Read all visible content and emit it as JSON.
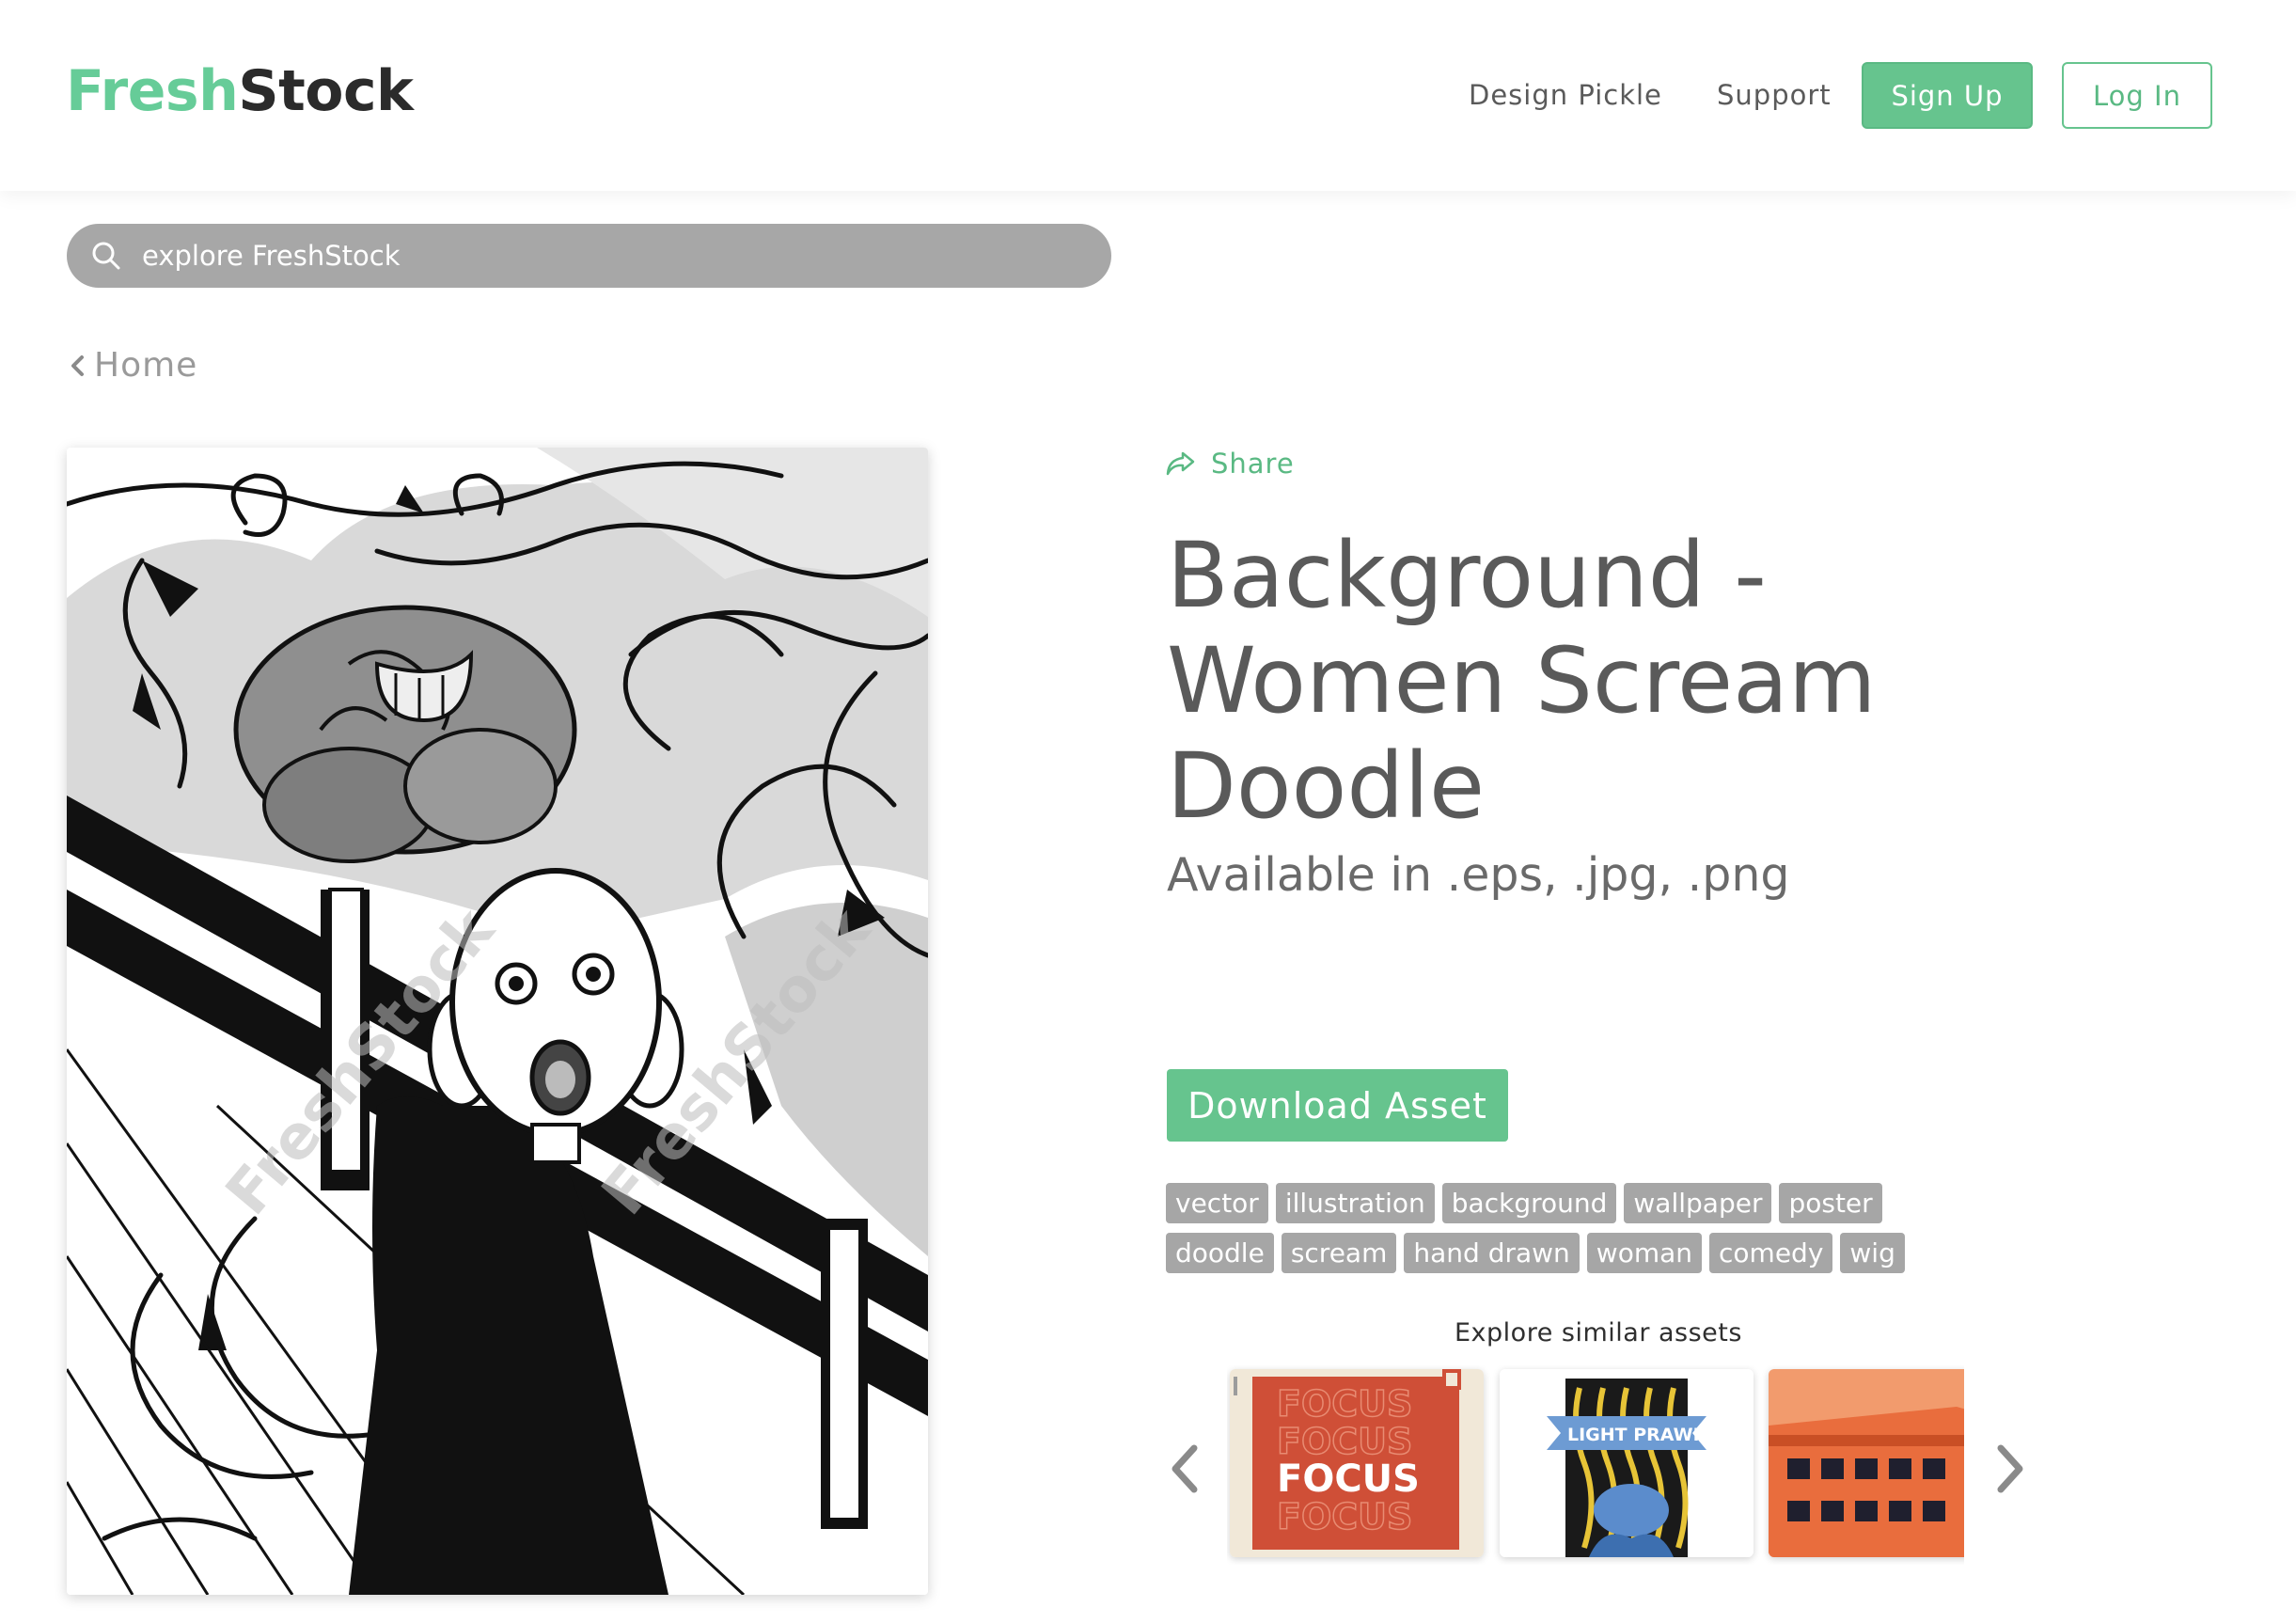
{
  "header": {
    "logo_fresh": "Fresh",
    "logo_stock": "Stock",
    "nav": [
      "Design Pickle",
      "Support"
    ],
    "signup_label": "Sign Up",
    "login_label": "Log In"
  },
  "search": {
    "placeholder": "explore FreshStock",
    "icon": "search-icon"
  },
  "breadcrumb": {
    "label": "Home",
    "icon": "chevron-left-icon"
  },
  "asset": {
    "image_description": "woman-scream-doodle-illustration",
    "watermark": "FreshStock",
    "share_label": "Share",
    "share_icon": "share-arrow-icon",
    "title": "Background - Women Scream Doodle",
    "formats": "Available in .eps, .jpg, .png",
    "download_label": "Download Asset",
    "tags": [
      "vector",
      "illustration",
      "background",
      "wallpaper",
      "poster",
      "doodle",
      "scream",
      "hand drawn",
      "woman",
      "comedy",
      "wig"
    ]
  },
  "similar": {
    "title": "Explore similar assets",
    "thumbs": [
      {
        "name": "focus-poster",
        "text": "FOCUS"
      },
      {
        "name": "light-prawn-poster",
        "text": "LIGHT PRAWN"
      },
      {
        "name": "building-illustration",
        "text": ""
      }
    ],
    "prev_icon": "chevron-left-icon",
    "next_icon": "chevron-right-icon"
  },
  "colors": {
    "brand_green": "#66c48e",
    "logo_dark": "#2b2b2b",
    "tag_gray": "#a6a6a6",
    "search_gray": "#a7a7a7"
  }
}
